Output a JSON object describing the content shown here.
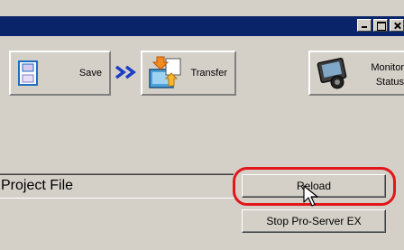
{
  "window": {
    "title_buttons": [
      "minimize",
      "maximize",
      "close"
    ]
  },
  "toolbar": {
    "save_label": "Save",
    "transfer_label": "Transfer",
    "monitor_label_line1": "Monitor",
    "monitor_label_line2": "Status"
  },
  "main": {
    "project_field_value": "Project File",
    "reload_label": "Reload",
    "stop_label": "Stop Pro-Server EX"
  },
  "colors": {
    "titlebar": "#0a246a",
    "face": "#d4d0c8",
    "highlight": "#e2161b",
    "arrow": "#1a3cc8"
  },
  "icons": [
    "minimize-icon",
    "maximize-icon",
    "close-icon",
    "save-icon",
    "double-chevron-right-icon",
    "transfer-icon",
    "monitor-status-icon",
    "mouse-pointer-icon"
  ]
}
